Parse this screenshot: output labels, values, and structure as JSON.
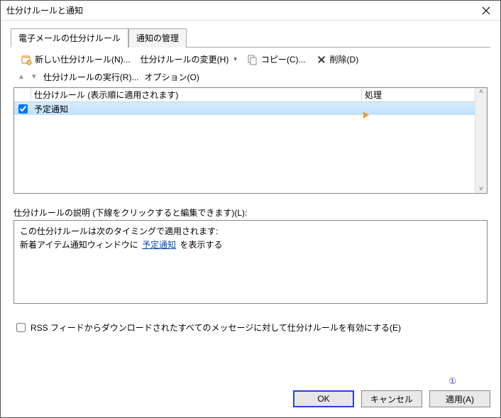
{
  "window": {
    "title": "仕分けルールと通知"
  },
  "tabs": {
    "mail": "電子メールの仕分けルール",
    "notify": "通知の管理"
  },
  "toolbar": {
    "new_rule": "新しい仕分けルール(N)...",
    "change_rule": "仕分けルールの変更(H)",
    "copy": "コピー(C)...",
    "delete": "削除(D)"
  },
  "subbar": {
    "run_rules": "仕分けルールの実行(R)...",
    "options": "オプション(O)"
  },
  "list": {
    "header_name": "仕分けルール (表示順に適用されます)",
    "header_proc": "処理",
    "rows": [
      {
        "checked": true,
        "name": "予定通知"
      }
    ]
  },
  "description": {
    "label": "仕分けルールの説明 (下線をクリックすると編集できます)(L):",
    "line1": "この仕分けルールは次のタイミングで適用されます:",
    "line2_pre": "新着アイテム通知ウィンドウに",
    "line2_link": "予定通知",
    "line2_post": "を表示する"
  },
  "rss": {
    "label": "RSS フィードからダウンロードされたすべてのメッセージに対して仕分けルールを有効にする(E)"
  },
  "footer": {
    "ok": "OK",
    "cancel": "キャンセル",
    "apply": "適用(A)"
  },
  "annotation": {
    "num": "①"
  }
}
